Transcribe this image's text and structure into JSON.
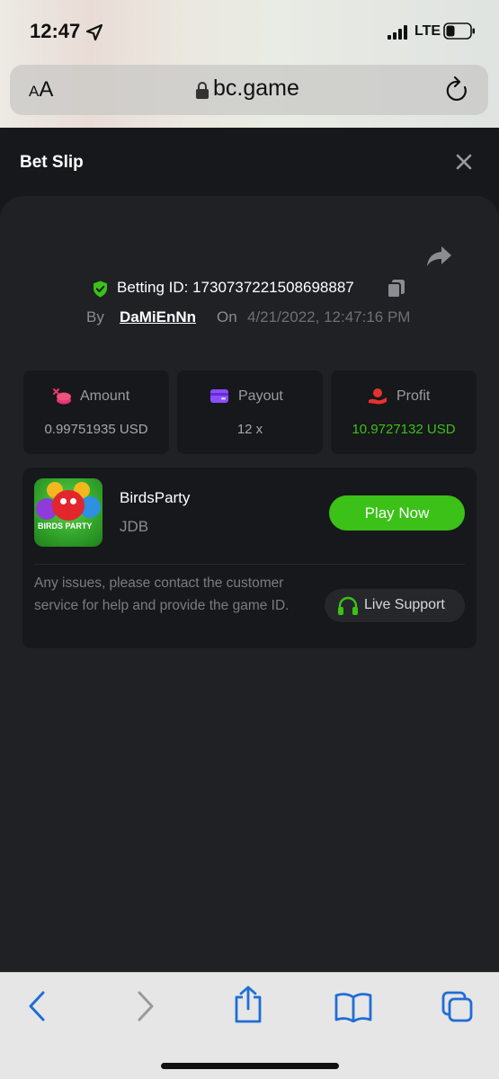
{
  "status_bar": {
    "time": "12:47",
    "network": "LTE"
  },
  "browser": {
    "text_size_label": "AA",
    "url": "bc.game"
  },
  "header": {
    "title": "Bet Slip"
  },
  "bet": {
    "betting_id_label": "Betting ID: 1730737221508698887",
    "by_label": "By",
    "username": "DaMiEnNn",
    "on_label": "On",
    "datetime": "4/21/2022, 12:47:16 PM"
  },
  "stats": [
    {
      "label": "Amount",
      "value": "0.99751935 USD",
      "icon": "coins-icon",
      "icon_color": "#e8356d"
    },
    {
      "label": "Payout",
      "value": "12 x",
      "icon": "wallet-icon",
      "icon_color": "#8b4dff"
    },
    {
      "label": "Profit",
      "value": "10.9727132 USD",
      "icon": "hand-money-icon",
      "icon_color": "#e7312f",
      "value_color": "#3bc117"
    }
  ],
  "game": {
    "name": "BirdsParty",
    "provider": "JDB",
    "thumb_text": "BIRDS PARTY",
    "play_label": "Play Now",
    "issue_text": "Any issues, please contact the customer service for help and provide the game ID.",
    "support_label": "Live Support"
  },
  "colors": {
    "accent_green": "#3bc117",
    "background": "#17181b",
    "card": "#202125",
    "ios_blue": "#1f6dd6"
  }
}
